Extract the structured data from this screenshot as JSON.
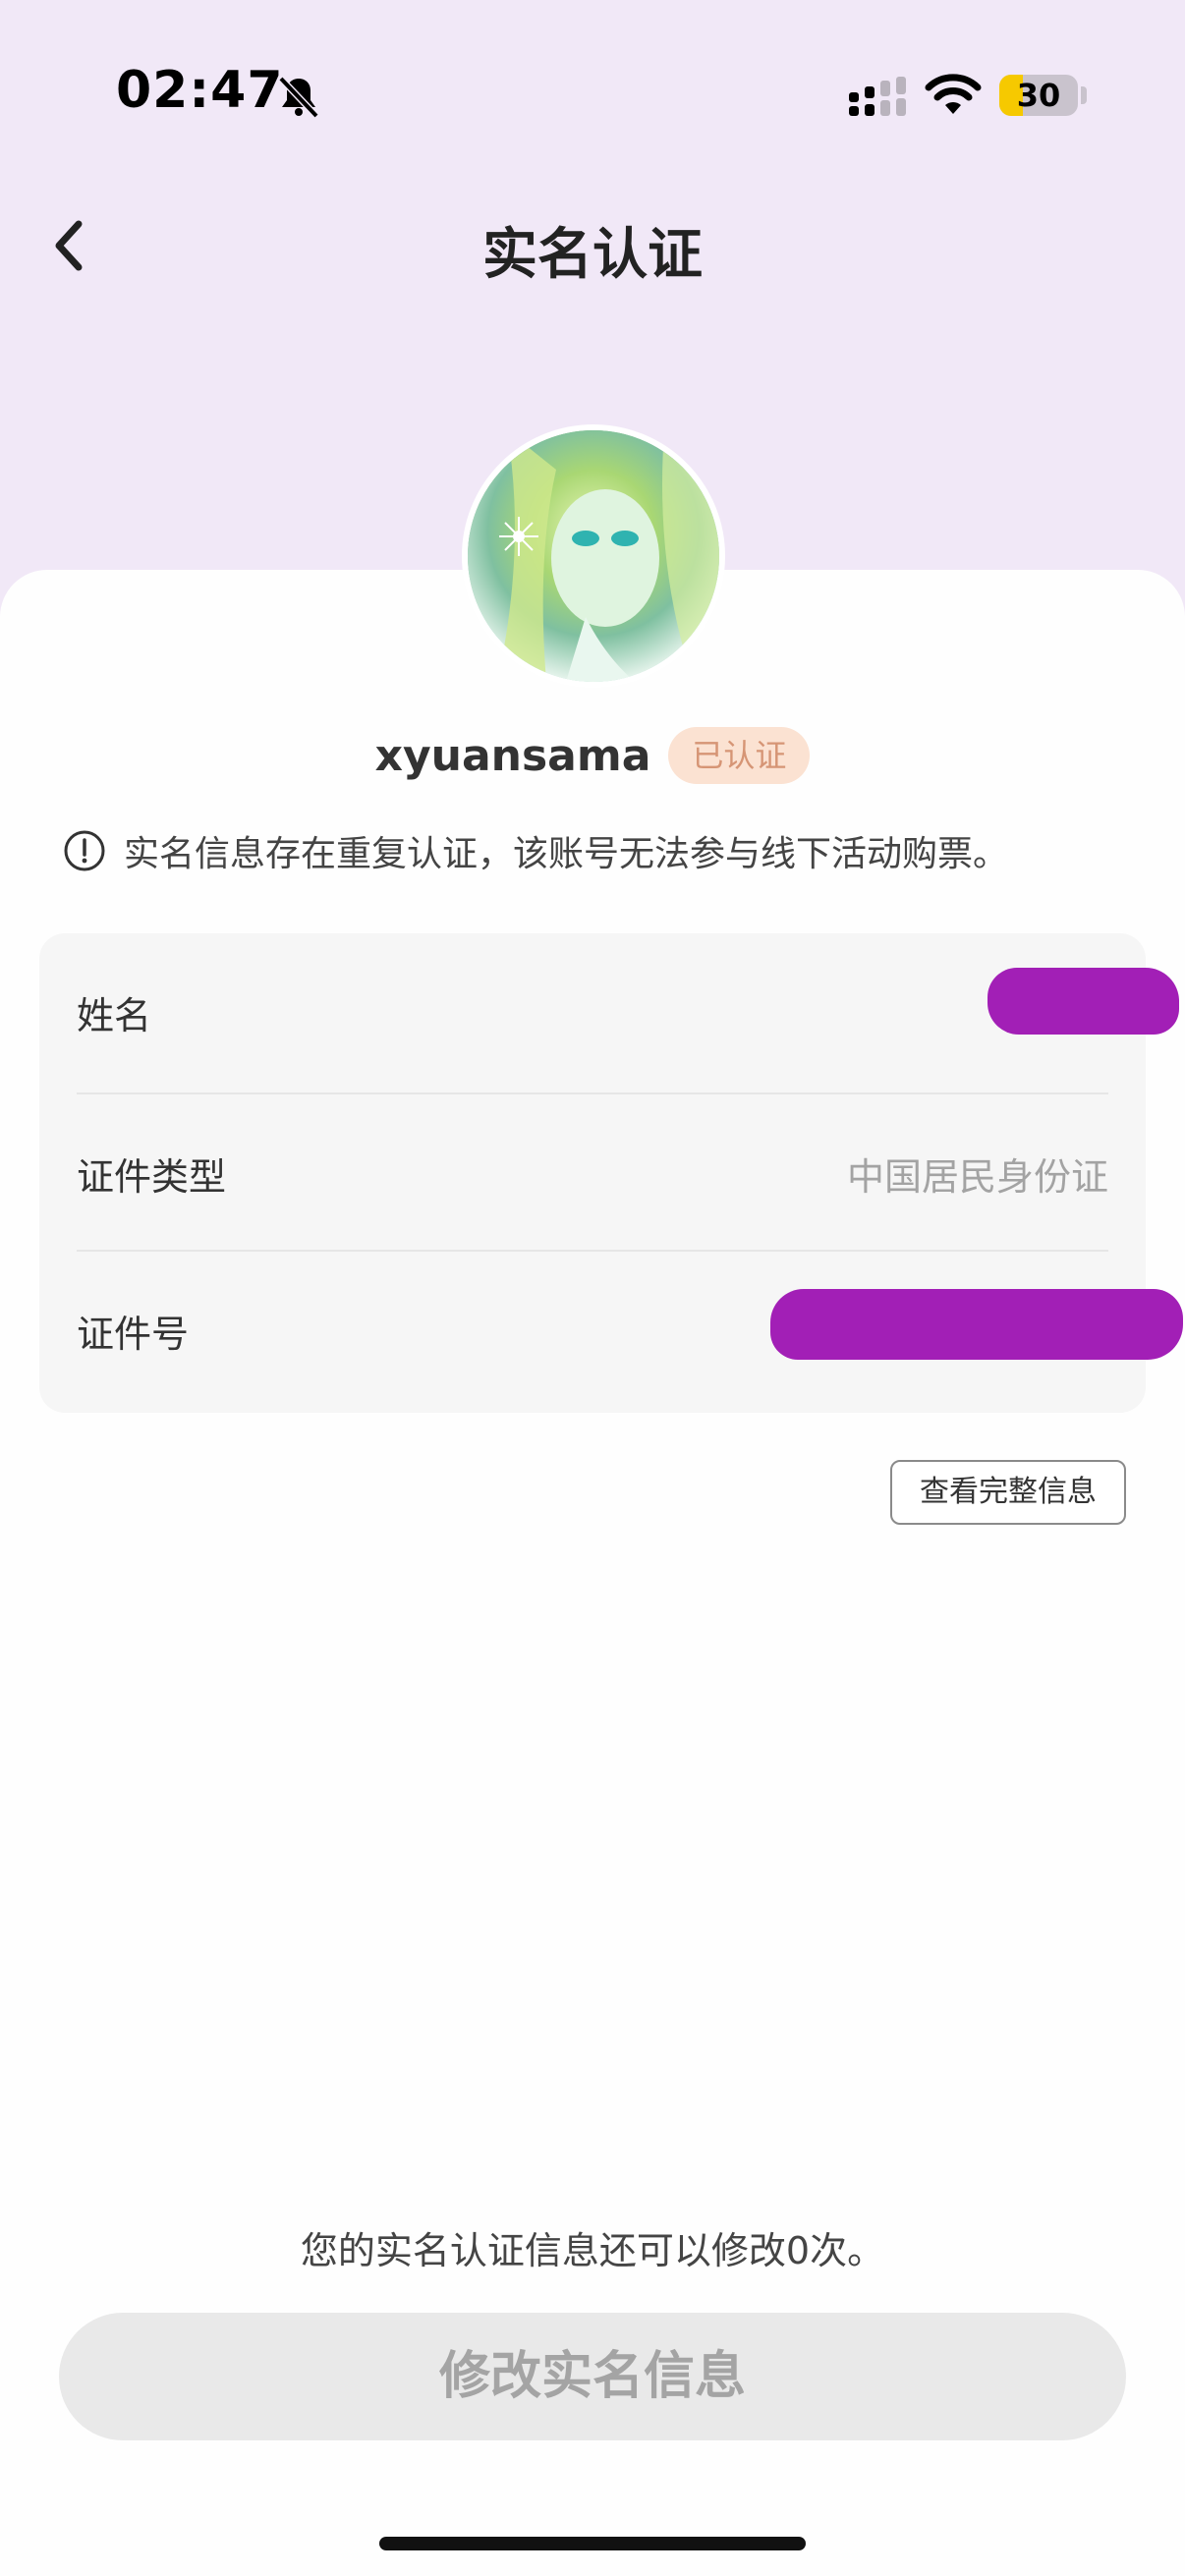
{
  "status_bar": {
    "time": "02:47",
    "battery": "30",
    "battery_level": 0.3,
    "icons": [
      "bell-slash-icon",
      "signal-icon",
      "wifi-icon",
      "battery-icon"
    ]
  },
  "nav": {
    "title": "实名认证",
    "back_icon": "chevron-left-icon"
  },
  "profile": {
    "username": "xyuansama",
    "badge": "已认证"
  },
  "notice": {
    "icon": "info-circle-icon",
    "text": "实名信息存在重复认证，该账号无法参与线下活动购票。"
  },
  "info": {
    "rows": [
      {
        "label": "姓名",
        "value": ""
      },
      {
        "label": "证件类型",
        "value": "中国居民身份证"
      },
      {
        "label": "证件号",
        "value": ""
      }
    ],
    "redaction_color": "#a21fb6"
  },
  "view_full_label": "查看完整信息",
  "remaining_text": "您的实名认证信息还可以修改0次。",
  "modify_button_label": "修改实名信息",
  "colors": {
    "header_bg": "#f1e8f7",
    "badge_bg": "#fbe2d2",
    "badge_text": "#d69575",
    "disabled_button_bg": "#e9e9e9"
  }
}
